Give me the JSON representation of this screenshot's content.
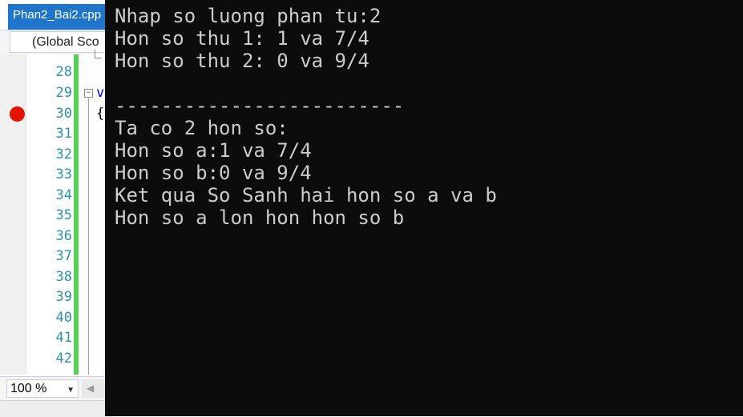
{
  "ide": {
    "file_tab": "Phan2_Bai2.cpp",
    "scope": "(Global Sco",
    "line_numbers": [
      "28",
      "29",
      "30",
      "31",
      "32",
      "33",
      "34",
      "35",
      "36",
      "37",
      "38",
      "39",
      "40",
      "41",
      "42"
    ],
    "code_fragment_v": "v",
    "code_fragment_brace": "{",
    "collapse_glyph": "−",
    "zoom": "100 %",
    "zoom_caret": "▼",
    "scroll_arrow": "◀",
    "colors": {
      "tab_active": "#1f75cc",
      "line_number": "#2b91af",
      "change_bar": "#57d057",
      "breakpoint": "#e51400"
    }
  },
  "console": {
    "lines": [
      "Nhap so luong phan tu:2",
      "Hon so thu 1: 1 va 7/4",
      "Hon so thu 2: 0 va 9/4",
      "",
      "-------------------------",
      "Ta co 2 hon so:",
      "Hon so a:1 va 7/4",
      "Hon so b:0 va 9/4",
      "Ket qua So Sanh hai hon so a va b",
      "Hon so a lon hon hon so b"
    ],
    "colors": {
      "background": "#0c0c0c",
      "text": "#cccccc"
    }
  }
}
